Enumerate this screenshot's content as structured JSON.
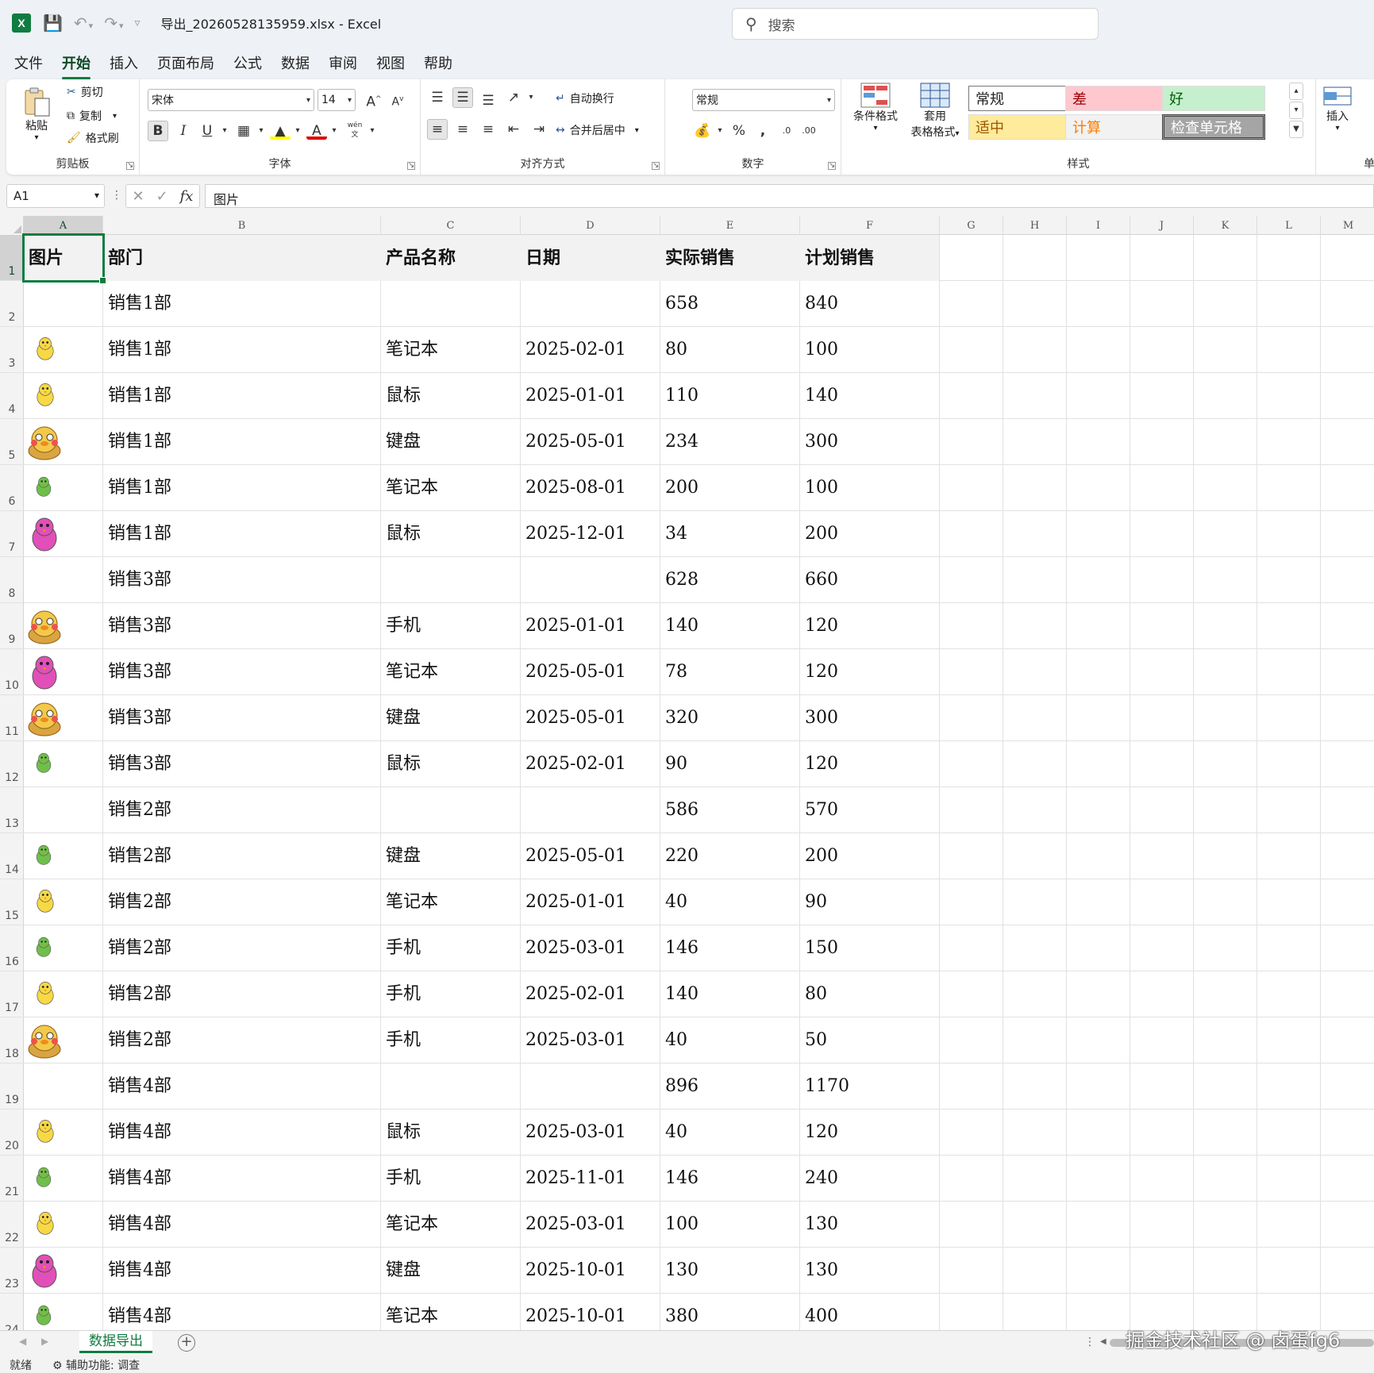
{
  "titlebar": {
    "excel_icon": "excel-icon",
    "doc_title": "导出_20260528135959.xlsx  -  Excel",
    "search_placeholder": "搜索"
  },
  "menu": [
    {
      "label": "文件",
      "active": false
    },
    {
      "label": "开始",
      "active": true
    },
    {
      "label": "插入",
      "active": false
    },
    {
      "label": "页面布局",
      "active": false
    },
    {
      "label": "公式",
      "active": false
    },
    {
      "label": "数据",
      "active": false
    },
    {
      "label": "审阅",
      "active": false
    },
    {
      "label": "视图",
      "active": false
    },
    {
      "label": "帮助",
      "active": false
    }
  ],
  "ribbon": {
    "clipboard": {
      "paste": "粘贴",
      "cut": "剪切",
      "copy": "复制",
      "format_painter": "格式刷",
      "label": "剪贴板"
    },
    "font": {
      "font_name": "宋体",
      "font_size": "14",
      "label": "字体",
      "phonetic": "wén"
    },
    "alignment": {
      "wrap_text": "自动换行",
      "merge_center": "合并后居中",
      "label": "对齐方式"
    },
    "number": {
      "format": "常规",
      "label": "数字"
    },
    "styles": {
      "conditional_formatting": "条件格式",
      "format_as_table_1": "套用",
      "format_as_table_2": "表格格式",
      "label": "样式",
      "cells": [
        {
          "label": "常规",
          "color": "#222222",
          "bg": "#ffffff"
        },
        {
          "label": "差",
          "color": "#9c0006",
          "bg": "#ffc7ce"
        },
        {
          "label": "好",
          "color": "#006100",
          "bg": "#c6efce"
        },
        {
          "label": "适中",
          "color": "#9c5700",
          "bg": "#ffeb9c"
        },
        {
          "label": "计算",
          "color": "#fa7d00",
          "bg": "#f2f2f2"
        },
        {
          "label": "检查单元格",
          "color": "#ffffff",
          "bg": "#a5a5a5"
        }
      ]
    },
    "cells_group": {
      "insert": "插入",
      "partial": "单"
    }
  },
  "formula_bar": {
    "name_box": "A1",
    "content": "图片"
  },
  "columns": [
    "A",
    "B",
    "C",
    "D",
    "E",
    "F",
    "G",
    "H",
    "I",
    "J",
    "K",
    "L",
    "M"
  ],
  "header_row": [
    "图片",
    "部门",
    "产品名称",
    "日期",
    "实际销售",
    "计划销售"
  ],
  "rows": [
    {
      "pic": "",
      "dept": "销售1部",
      "product": "",
      "date": "",
      "actual": "658",
      "plan": "840"
    },
    {
      "pic": "yellow-chick",
      "dept": "销售1部",
      "product": "笔记本",
      "date": "2025-02-01",
      "actual": "80",
      "plan": "100"
    },
    {
      "pic": "yellow-chick",
      "dept": "销售1部",
      "product": "鼠标",
      "date": "2025-01-01",
      "actual": "110",
      "plan": "140"
    },
    {
      "pic": "basket-chick",
      "dept": "销售1部",
      "product": "键盘",
      "date": "2025-05-01",
      "actual": "234",
      "plan": "300"
    },
    {
      "pic": "green-chick",
      "dept": "销售1部",
      "product": "笔记本",
      "date": "2025-08-01",
      "actual": "200",
      "plan": "100"
    },
    {
      "pic": "pink-chick",
      "dept": "销售1部",
      "product": "鼠标",
      "date": "2025-12-01",
      "actual": "34",
      "plan": "200"
    },
    {
      "pic": "",
      "dept": "销售3部",
      "product": "",
      "date": "",
      "actual": "628",
      "plan": "660"
    },
    {
      "pic": "basket-chick",
      "dept": "销售3部",
      "product": "手机",
      "date": "2025-01-01",
      "actual": "140",
      "plan": "120"
    },
    {
      "pic": "pink-chick",
      "dept": "销售3部",
      "product": "笔记本",
      "date": "2025-05-01",
      "actual": "78",
      "plan": "120"
    },
    {
      "pic": "basket-chick",
      "dept": "销售3部",
      "product": "键盘",
      "date": "2025-05-01",
      "actual": "320",
      "plan": "300"
    },
    {
      "pic": "green-chick",
      "dept": "销售3部",
      "product": "鼠标",
      "date": "2025-02-01",
      "actual": "90",
      "plan": "120"
    },
    {
      "pic": "",
      "dept": "销售2部",
      "product": "",
      "date": "",
      "actual": "586",
      "plan": "570"
    },
    {
      "pic": "green-chick",
      "dept": "销售2部",
      "product": "键盘",
      "date": "2025-05-01",
      "actual": "220",
      "plan": "200"
    },
    {
      "pic": "yellow-chick",
      "dept": "销售2部",
      "product": "笔记本",
      "date": "2025-01-01",
      "actual": "40",
      "plan": "90"
    },
    {
      "pic": "green-chick",
      "dept": "销售2部",
      "product": "手机",
      "date": "2025-03-01",
      "actual": "146",
      "plan": "150"
    },
    {
      "pic": "yellow-chick",
      "dept": "销售2部",
      "product": "手机",
      "date": "2025-02-01",
      "actual": "140",
      "plan": "80"
    },
    {
      "pic": "basket-chick",
      "dept": "销售2部",
      "product": "手机",
      "date": "2025-03-01",
      "actual": "40",
      "plan": "50"
    },
    {
      "pic": "",
      "dept": "销售4部",
      "product": "",
      "date": "",
      "actual": "896",
      "plan": "1170"
    },
    {
      "pic": "yellow-chick",
      "dept": "销售4部",
      "product": "鼠标",
      "date": "2025-03-01",
      "actual": "40",
      "plan": "120"
    },
    {
      "pic": "green-chick",
      "dept": "销售4部",
      "product": "手机",
      "date": "2025-11-01",
      "actual": "146",
      "plan": "240"
    },
    {
      "pic": "yellow-chick",
      "dept": "销售4部",
      "product": "笔记本",
      "date": "2025-03-01",
      "actual": "100",
      "plan": "130"
    },
    {
      "pic": "pink-chick",
      "dept": "销售4部",
      "product": "键盘",
      "date": "2025-10-01",
      "actual": "130",
      "plan": "130"
    },
    {
      "pic": "green-chick",
      "dept": "销售4部",
      "product": "笔记本",
      "date": "2025-10-01",
      "actual": "380",
      "plan": "400"
    }
  ],
  "row_numbers": [
    "1",
    "2",
    "3",
    "4",
    "5",
    "6",
    "7",
    "8",
    "9",
    "10",
    "11",
    "12",
    "13",
    "14",
    "15",
    "16",
    "17",
    "18",
    "19",
    "20",
    "21",
    "22",
    "23",
    "24"
  ],
  "sheet_tab": "数据导出",
  "watermark": "掘金技术社区 @ 卤蛋fg6",
  "status": {
    "ready": "就绪",
    "accessibility": "辅助功能: 调查"
  },
  "colors": {
    "accent": "#107c41",
    "grid_line": "#e1e1e1",
    "header_fill": "#f2f2f2"
  }
}
